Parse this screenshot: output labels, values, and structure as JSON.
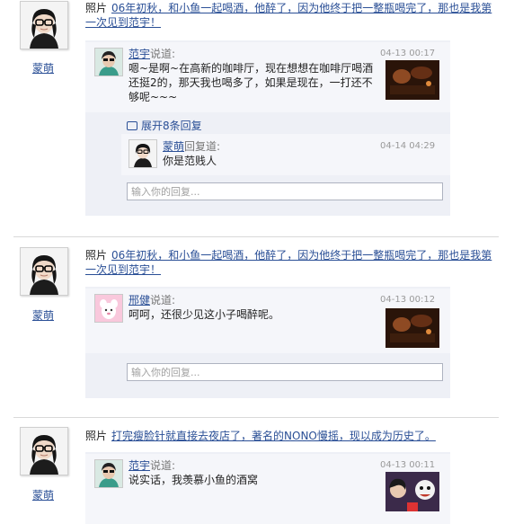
{
  "posts": [
    {
      "author": "蒙萌",
      "type_label": "照片",
      "share_text": "06年初秋，和小鱼一起喝酒，他醉了，因为他终于把一整瓶喝完了，那也是我第一次见到范宇！",
      "comments": [
        {
          "user": "范宇",
          "said": "说道:",
          "time": "04-13 00:17",
          "text": "嗯~是啊~在高新的咖啡厅，现在想想在咖啡厅喝酒还挺2的，那天我也喝多了，如果是现在，一打还不够呢~~~"
        }
      ],
      "expand_label": "展开8条回复",
      "reply": {
        "user": "蒙萌",
        "said": "回复道:",
        "time": "04-14 04:29",
        "text": "你是范贱人"
      },
      "reply_placeholder": "输入你的回复..."
    },
    {
      "author": "蒙萌",
      "type_label": "照片",
      "share_text": "06年初秋，和小鱼一起喝酒，他醉了，因为他终于把一整瓶喝完了，那也是我第一次见到范宇！",
      "comments": [
        {
          "user": "邢健",
          "said": "说道:",
          "time": "04-13 00:12",
          "text": "呵呵，还很少见这小子喝醉呢。"
        }
      ],
      "reply_placeholder": "输入你的回复..."
    },
    {
      "author": "蒙萌",
      "type_label": "照片",
      "share_text": "打完瘦脸针就直接去夜店了，著名的NONO慢摇，现以成为历史了。",
      "comments": [
        {
          "user": "范宇",
          "said": "说道:",
          "time": "04-13 00:11",
          "text": "说实话，我羡慕小鱼的酒窝"
        }
      ]
    }
  ],
  "icons": {
    "expand": "comment-bubble-icon"
  },
  "colors": {
    "link": "#2a4f96",
    "comment_bg": "#eef0f6",
    "separator": "#d9d9d9"
  }
}
